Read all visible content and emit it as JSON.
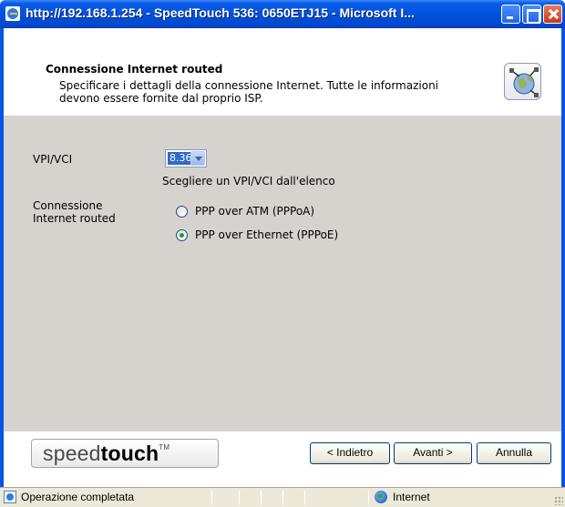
{
  "window": {
    "title": "http://192.168.1.254 - SpeedTouch 536:  0650ETJ15 - Microsoft I..."
  },
  "header": {
    "title": "Connessione Internet routed",
    "description": "Specificare i dettagli della connessione Internet. Tutte le informazioni devono essere fornite dal proprio ISP."
  },
  "form": {
    "vpi_label": "VPI/VCI",
    "vpi_value": "8.36",
    "vpi_hint": "Scegliere un VPI/VCI dall'elenco",
    "connection_label": "Connessione Internet routed",
    "options": [
      {
        "label": "PPP over ATM (PPPoA)",
        "checked": false
      },
      {
        "label": "PPP over Ethernet (PPPoE)",
        "checked": true
      }
    ]
  },
  "footer": {
    "brand_light": "speed",
    "brand_bold": "touch",
    "brand_tm": "TM",
    "back_label": "< Indietro",
    "next_label": "Avanti >",
    "cancel_label": "Annulla"
  },
  "statusbar": {
    "status_text": "Operazione completata",
    "zone_text": "Internet"
  }
}
